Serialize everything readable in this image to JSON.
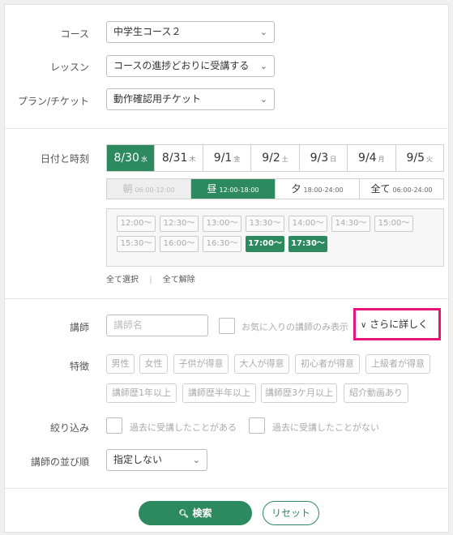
{
  "course": {
    "label": "コース",
    "value": "中学生コース２"
  },
  "lesson": {
    "label": "レッスン",
    "value": "コースの進捗どおりに受講する"
  },
  "plan": {
    "label": "プラン/チケット",
    "value": "動作確認用チケット"
  },
  "datetime": {
    "label": "日付と時刻",
    "dates": [
      {
        "day": "8/30",
        "weekday": "水",
        "selected": true
      },
      {
        "day": "8/31",
        "weekday": "木",
        "selected": false
      },
      {
        "day": "9/1",
        "weekday": "金",
        "selected": false
      },
      {
        "day": "9/2",
        "weekday": "土",
        "selected": false
      },
      {
        "day": "9/3",
        "weekday": "日",
        "selected": false
      },
      {
        "day": "9/4",
        "weekday": "月",
        "selected": false
      },
      {
        "day": "9/5",
        "weekday": "火",
        "selected": false
      }
    ],
    "periods": [
      {
        "name": "朝",
        "range": "06:00-12:00",
        "state": "disabled"
      },
      {
        "name": "昼",
        "range": "12:00-18:00",
        "state": "active"
      },
      {
        "name": "夕",
        "range": "18:00-24:00",
        "state": "normal"
      },
      {
        "name": "全て",
        "range": "06:00-24:00",
        "state": "normal"
      }
    ],
    "slots": [
      {
        "t": "12:00〜",
        "on": false
      },
      {
        "t": "12:30〜",
        "on": false
      },
      {
        "t": "13:00〜",
        "on": false
      },
      {
        "t": "13:30〜",
        "on": false
      },
      {
        "t": "14:00〜",
        "on": false
      },
      {
        "t": "14:30〜",
        "on": false
      },
      {
        "t": "15:00〜",
        "on": false
      },
      {
        "t": "15:30〜",
        "on": false
      },
      {
        "t": "16:00〜",
        "on": false
      },
      {
        "t": "16:30〜",
        "on": false
      },
      {
        "t": "17:00〜",
        "on": true
      },
      {
        "t": "17:30〜",
        "on": true
      }
    ],
    "select_all": "全て選択",
    "deselect_all": "全て解除"
  },
  "teacher": {
    "label": "講師",
    "placeholder": "講師名",
    "favorites_only": "お気に入りの講師のみ表示",
    "more": "さらに詳しく"
  },
  "features": {
    "label": "特徴",
    "tags": [
      "男性",
      "女性",
      "子供が得意",
      "大人が得意",
      "初心者が得意",
      "上級者が得意",
      "講師歴1年以上",
      "講師歴半年以上",
      "講師歴3ケ月以上",
      "紹介動画あり"
    ]
  },
  "filter": {
    "label": "絞り込み",
    "taken_before": "過去に受講したことがある",
    "never_taken": "過去に受講したことがない"
  },
  "sort": {
    "label": "講師の並び順",
    "value": "指定しない"
  },
  "actions": {
    "search": "検索",
    "reset": "リセット"
  },
  "colors": {
    "accent": "#2d8a5f",
    "highlight": "#e8157b"
  }
}
